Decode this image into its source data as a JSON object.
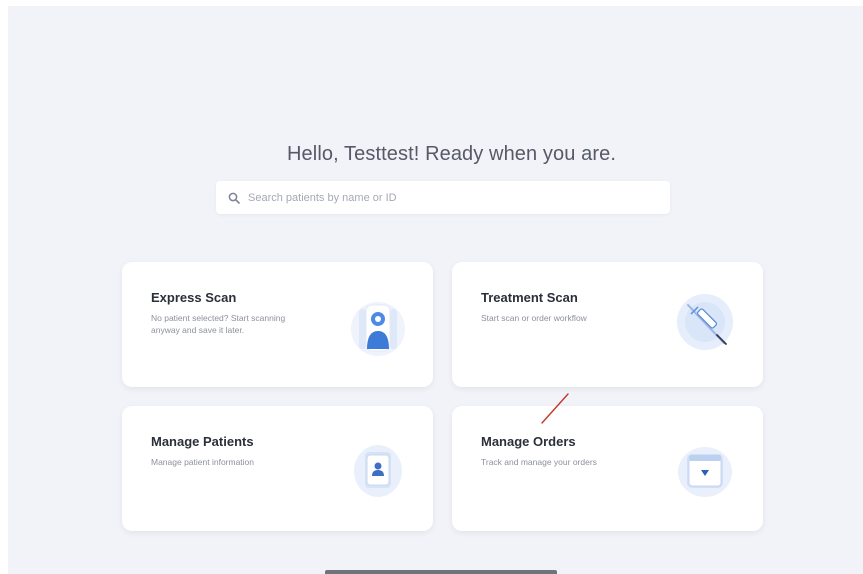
{
  "greeting": "Hello, Testtest! Ready when you are.",
  "search": {
    "placeholder": "Search patients by name or ID",
    "icon": "search-icon"
  },
  "cards": {
    "express": {
      "title": "Express Scan",
      "description": "No patient selected? Start scanning anyway and save it later.",
      "icon": "scan-person-icon"
    },
    "treatment": {
      "title": "Treatment Scan",
      "description": "Start scan or order workflow",
      "icon": "syringe-icon"
    },
    "patients": {
      "title": "Manage Patients",
      "description": "Manage patient information",
      "icon": "patient-card-icon"
    },
    "orders": {
      "title": "Manage Orders",
      "description": "Track and manage your orders",
      "icon": "orders-box-icon"
    }
  },
  "colors": {
    "background": "#f1f3f8",
    "card": "#ffffff",
    "accent": "#3d7bd9",
    "annotation": "#c0392b"
  }
}
